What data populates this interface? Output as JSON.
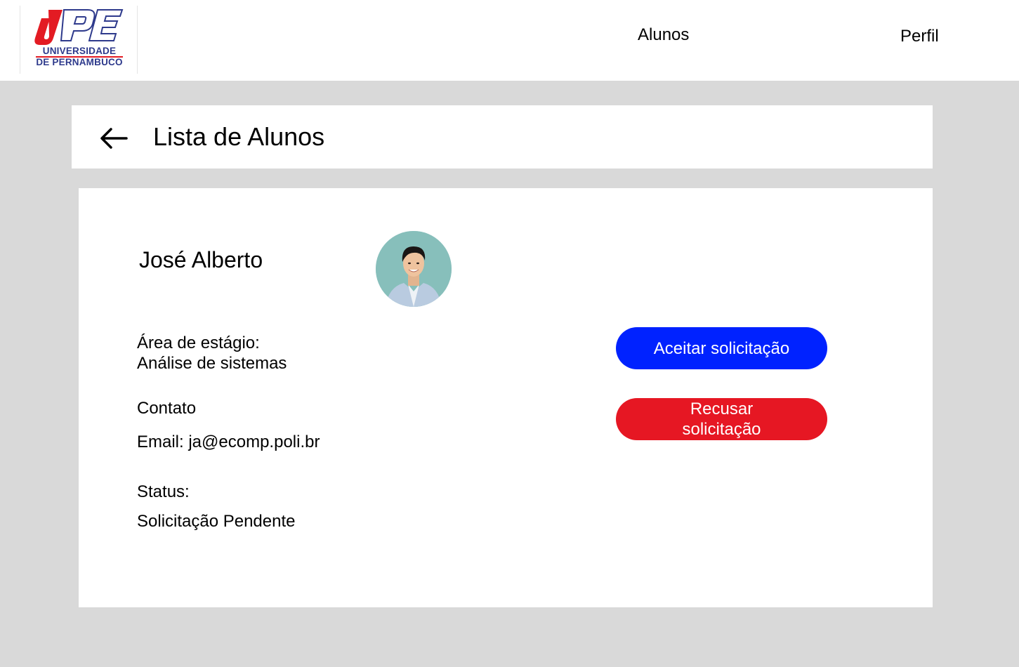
{
  "header": {
    "logo": {
      "mark": "UPE",
      "line1": "UNIVERSIDADE",
      "line2": "DE PERNAMBUCO",
      "colors": {
        "red": "#e31b23",
        "blue": "#2e3a8c"
      }
    },
    "nav": {
      "alunos": "Alunos",
      "perfil": "Perfil"
    }
  },
  "title_bar": {
    "back_icon": "arrow-left-icon",
    "title": "Lista de Alunos"
  },
  "student": {
    "name": "José Alberto",
    "avatar": "student-photo",
    "area_label": "Área de estágio:",
    "area_value": "Análise de sistemas",
    "contact_label": "Contato",
    "email": "Email: ja@ecomp.poli.br",
    "status_label": "Status:",
    "status_value": "Solicitação Pendente"
  },
  "actions": {
    "accept_label": "Aceitar solicitação",
    "reject_label": "Recusar solicitação",
    "accept_color": "#0022ff",
    "reject_color": "#e61723"
  }
}
